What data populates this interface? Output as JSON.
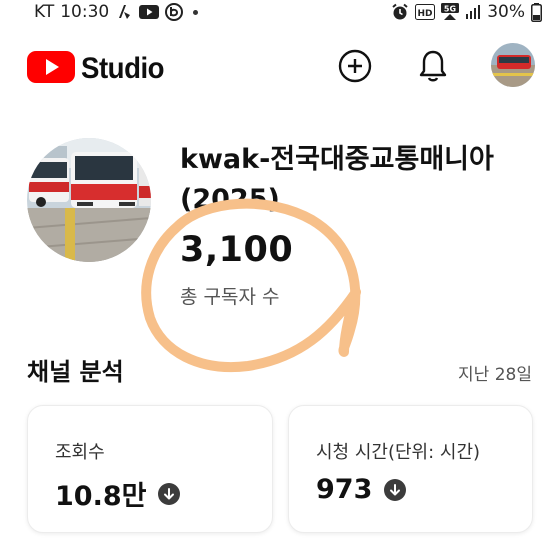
{
  "status_bar": {
    "carrier": "KT",
    "time": "10:30",
    "network": "5G",
    "hd": "HD",
    "battery": "30%"
  },
  "header": {
    "logo_text": "Studio",
    "brand_color": "#ff0000"
  },
  "channel": {
    "name": "kwak-전국대중교통매니아 (2025)",
    "subscriber_count": "3,100",
    "subscriber_label": "총 구독자 수"
  },
  "analytics": {
    "title": "채널 분석",
    "period": "지난 28일",
    "cards": [
      {
        "label": "조회수",
        "value": "10.8만",
        "trend_icon": "arrow-down-circle-icon"
      },
      {
        "label": "시청 시간(단위: 시간)",
        "value": "973",
        "trend_icon": "arrow-down-circle-icon"
      }
    ]
  },
  "annotation_color": "#f7c08a"
}
